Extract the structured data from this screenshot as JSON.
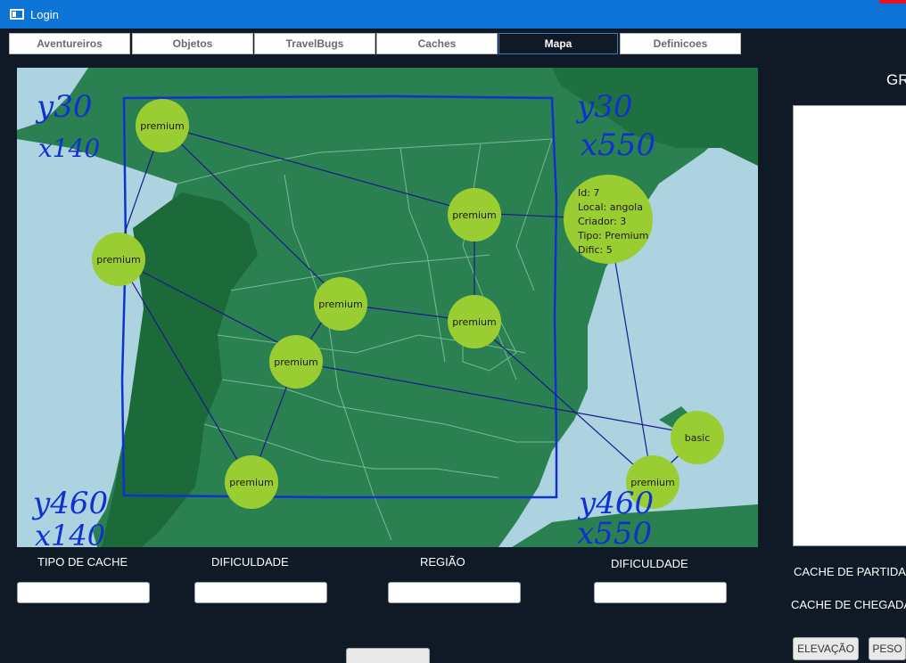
{
  "window": {
    "title": "Login"
  },
  "tabs": [
    {
      "label": "Aventureiros"
    },
    {
      "label": "Objetos"
    },
    {
      "label": "TravelBugs"
    },
    {
      "label": "Caches"
    },
    {
      "label": "Mapa",
      "active": true
    },
    {
      "label": "Definicoes"
    }
  ],
  "map": {
    "nodes": [
      {
        "id": "n1",
        "label": "premium"
      },
      {
        "id": "n2",
        "label": "premium"
      },
      {
        "id": "n3",
        "label": "premium"
      },
      {
        "id": "n4",
        "label": "premium"
      },
      {
        "id": "n5",
        "label": "premium"
      },
      {
        "id": "n6",
        "label": "premium"
      },
      {
        "id": "n7",
        "label": "premium"
      },
      {
        "id": "n8",
        "label": "premium"
      },
      {
        "id": "n9",
        "label": "basic"
      }
    ],
    "selected_info": {
      "id": "Id: 7",
      "local": "Local: angola",
      "criador": "Criador: 3",
      "tipo": "Tipo: Premium",
      "dific": "Dific: 5"
    },
    "annotations": {
      "tl_y": "y30",
      "tl_x": "x140",
      "tr_y": "y30",
      "tr_x": "x550",
      "bl_y": "y460",
      "bl_x": "x140",
      "br_y": "y460",
      "br_x": "x550"
    },
    "colors": {
      "sea": "#acd3df",
      "land": "#2a8050",
      "portugal": "#1c6a3a",
      "node": "#9acd32",
      "edge": "#1a1a8c",
      "ink": "#1030d0"
    }
  },
  "right_panel": {
    "title": "GR"
  },
  "filters": {
    "tipo_cache_label": "TIPO DE CACHE",
    "dificuldade_label": "DIFICULDADE",
    "regiao_label": "REGIÃO",
    "dificuldade2_label": "DIFICULDADE"
  },
  "route": {
    "partida_label": "CACHE DE PARTIDA",
    "chegada_label": "CACHE DE CHEGADA",
    "elevacao_button": "ELEVAÇÃO",
    "peso_button": "PESO"
  }
}
